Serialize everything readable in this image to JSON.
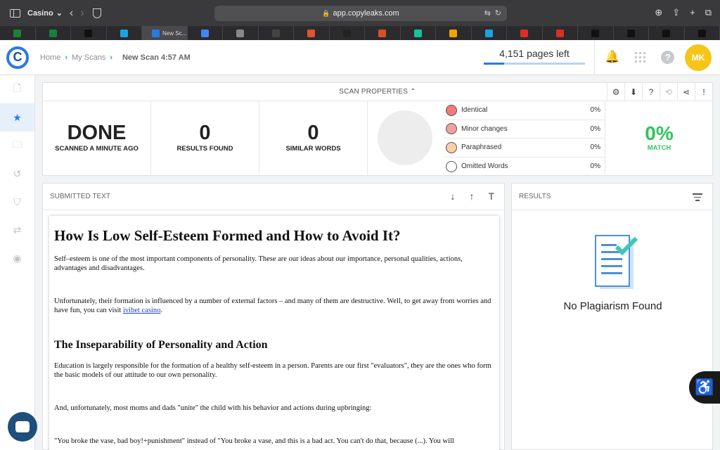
{
  "browser": {
    "tab_group": "Casino",
    "url": "app.copyleaks.com",
    "tabs": [
      {
        "label": "",
        "color": "#188038"
      },
      {
        "label": "",
        "color": "#188038"
      },
      {
        "label": "",
        "color": "#111111"
      },
      {
        "label": "",
        "color": "#1aa3e0"
      },
      {
        "label": "New Sc...",
        "color": "#2a7ae2"
      },
      {
        "label": "",
        "color": "#4285f4"
      },
      {
        "label": "",
        "color": "#888888"
      },
      {
        "label": "",
        "color": "#444444"
      },
      {
        "label": "",
        "color": "#e0542e"
      },
      {
        "label": "",
        "color": "#222222"
      },
      {
        "label": "",
        "color": "#d94f2b"
      },
      {
        "label": "",
        "color": "#15c39a"
      },
      {
        "label": "",
        "color": "#f0a500"
      },
      {
        "label": "",
        "color": "#1aa3e0"
      },
      {
        "label": "",
        "color": "#d93025"
      },
      {
        "label": "",
        "color": "#d93025"
      },
      {
        "label": "",
        "color": "#111111"
      },
      {
        "label": "",
        "color": "#111111"
      },
      {
        "label": "",
        "color": "#111111"
      },
      {
        "label": "",
        "color": "#111111"
      }
    ]
  },
  "header": {
    "logo_letter": "C",
    "breadcrumb": [
      "Home",
      "My Scans"
    ],
    "current": "New Scan 4:57 AM",
    "pages_left": "4,151 pages left",
    "pages_progress": 0.2,
    "avatar": "MK"
  },
  "scan_properties": {
    "title": "SCAN PROPERTIES",
    "status": {
      "value": "DONE",
      "label": "SCANNED A MINUTE AGO"
    },
    "results": {
      "value": "0",
      "label": "RESULTS FOUND"
    },
    "similar": {
      "value": "0",
      "label": "SIMILAR WORDS"
    },
    "legend": [
      {
        "name": "Identical",
        "value": "0%",
        "color": "#f07b7b"
      },
      {
        "name": "Minor changes",
        "value": "0%",
        "color": "#f2a0a0"
      },
      {
        "name": "Paraphrased",
        "value": "0%",
        "color": "#f8cfa6"
      },
      {
        "name": "Omitted Words",
        "value": "0%",
        "color": "#ffffff"
      }
    ],
    "match": {
      "value": "0%",
      "label": "MATCH"
    }
  },
  "submitted": {
    "title": "SUBMITTED TEXT",
    "h1": "How Is Low Self-Esteem Formed and How to Avoid It?",
    "p1": "Self–esteem is one of the most important components of personality. These are our ideas about our importance, personal qualities, actions, advantages and disadvantages.",
    "p2_before": "Unfortunately, their formation is influenced by a number of external factors – and many of them are destructive. Well, to get away from worries and have fun, you can visit ",
    "p2_link": "ivibet casino",
    "p2_after": ".",
    "h2": "The Inseparability of Personality and Action",
    "p3": "Education is largely responsible for the formation of a healthy self-esteem in a person. Parents are our first \"evaluators\", they are the ones who form the basic models of our attitude to our own personality.",
    "p4": "And, unfortunately, most moms and dads \"unite\" the child with his behavior and actions during upbringing:",
    "p5": "\"You broke the vase, bad boy!+punishment\" instead of \"You broke a vase, and this is a bad act. You can't do that, because (...). You will"
  },
  "results": {
    "title": "RESULTS",
    "empty_text": "No Plagiarism Found"
  }
}
